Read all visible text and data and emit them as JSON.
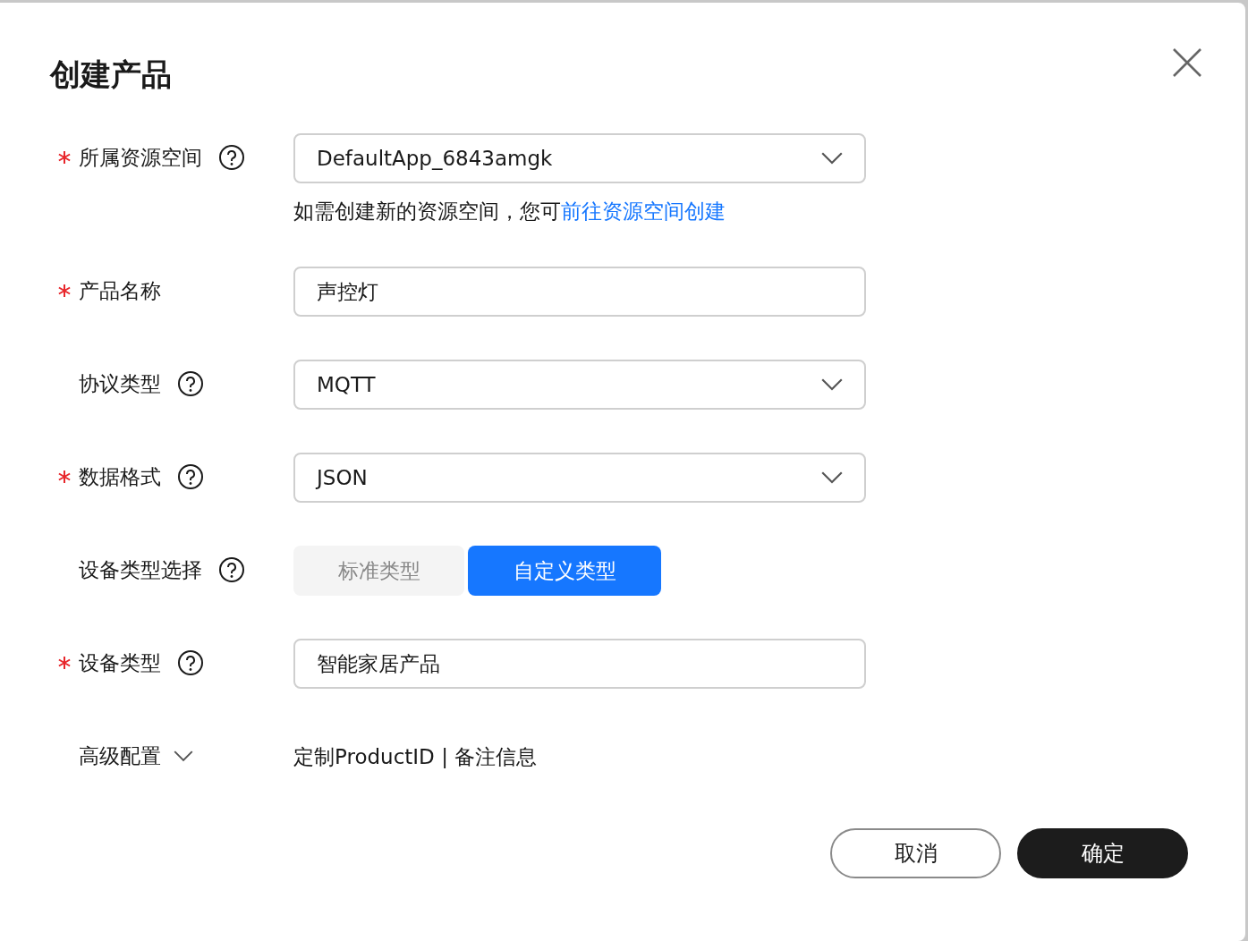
{
  "dialog": {
    "title": "创建产品"
  },
  "fields": [
    {
      "kind": "select",
      "label": "所属资源空间",
      "required": true,
      "help": true,
      "value": "DefaultApp_6843amgk",
      "note": {
        "text": "如需创建新的资源空间，您可",
        "link": "前往资源空间创建"
      }
    },
    {
      "kind": "input",
      "label": "产品名称",
      "required": true,
      "help": false,
      "value": "声控灯"
    },
    {
      "kind": "select",
      "label": "协议类型",
      "required": false,
      "help": true,
      "value": "MQTT"
    },
    {
      "kind": "select",
      "label": "数据格式",
      "required": true,
      "help": true,
      "value": "JSON"
    },
    {
      "kind": "toggle",
      "label": "设备类型选择",
      "required": false,
      "help": true,
      "options": [
        {
          "label": "标准类型",
          "selected": false
        },
        {
          "label": "自定义类型",
          "selected": true
        }
      ]
    },
    {
      "kind": "input",
      "label": "设备类型",
      "required": true,
      "help": true,
      "value": "智能家居产品"
    },
    {
      "kind": "advanced",
      "label": "高级配置",
      "required": false,
      "help": false,
      "expanded": false,
      "value": "定制ProductID | 备注信息"
    }
  ],
  "buttons": [
    {
      "label": "取消",
      "kind": "secondary"
    },
    {
      "label": "确定",
      "kind": "primary"
    }
  ]
}
